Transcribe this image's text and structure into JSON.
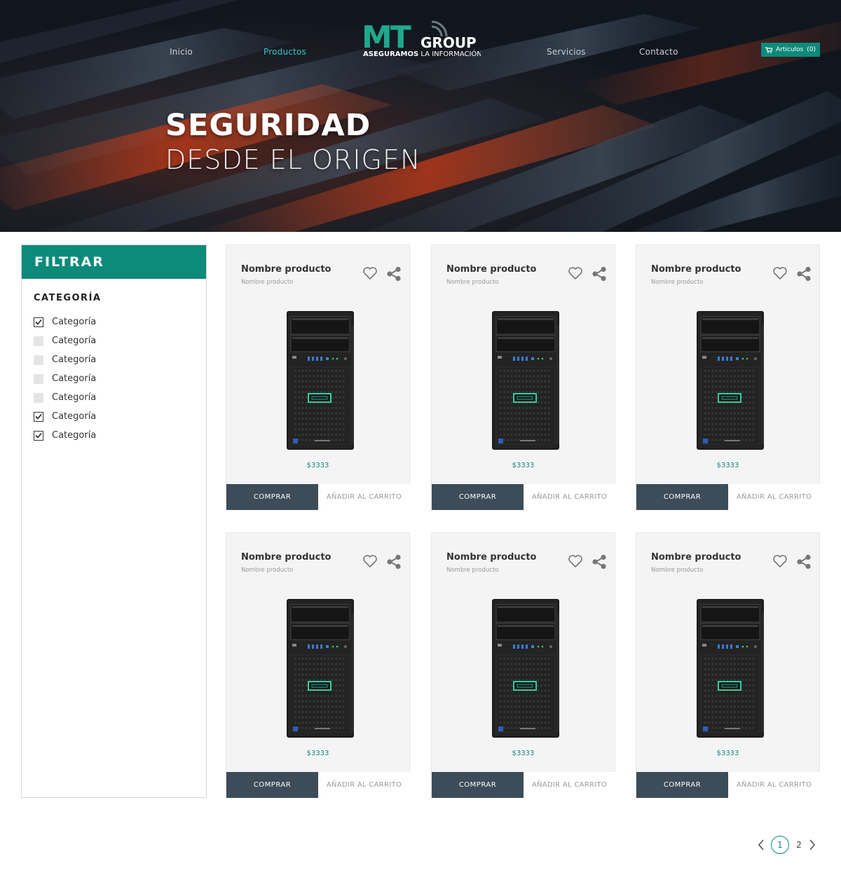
{
  "nav": {
    "items": [
      {
        "label": "Inicio",
        "active": false
      },
      {
        "label": "Productos",
        "active": true
      },
      {
        "label": "Servicios",
        "active": false
      },
      {
        "label": "Contacto",
        "active": false
      }
    ]
  },
  "logo": {
    "brand_initials": "MT",
    "brand_suffix": "GROUP",
    "tagline_bold": "ASEGURAMOS",
    "tagline_rest": " LA INFORMACIÓN"
  },
  "cart": {
    "label": "Articulos",
    "count": "(0)"
  },
  "hero": {
    "title": "SEGURIDAD",
    "subtitle": "DESDE EL ORIGEN"
  },
  "filter": {
    "title": "FILTRAR",
    "category_title": "CATEGORÍA",
    "categories": [
      {
        "label": "Categoría",
        "checked": true
      },
      {
        "label": "Categoría",
        "checked": false
      },
      {
        "label": "Categoría",
        "checked": false
      },
      {
        "label": "Categoría",
        "checked": false
      },
      {
        "label": "Categoría",
        "checked": false
      },
      {
        "label": "Categoría",
        "checked": true
      },
      {
        "label": "Categoría",
        "checked": true
      }
    ]
  },
  "products": [
    {
      "name": "Nombre producto",
      "subtitle": "Nombre producto",
      "price": "$3333",
      "buy_label": "COMPRAR",
      "cart_label": "AÑADIR AL CARRITO"
    },
    {
      "name": "Nombre producto",
      "subtitle": "Nombre producto",
      "price": "$3333",
      "buy_label": "COMPRAR",
      "cart_label": "AÑADIR AL CARRITO"
    },
    {
      "name": "Nombre producto",
      "subtitle": "Nombre producto",
      "price": "$3333",
      "buy_label": "COMPRAR",
      "cart_label": "AÑADIR AL CARRITO"
    },
    {
      "name": "Nombre producto",
      "subtitle": "Nombre producto",
      "price": "$3333",
      "buy_label": "COMPRAR",
      "cart_label": "AÑADIR AL CARRITO"
    },
    {
      "name": "Nombre producto",
      "subtitle": "Nombre producto",
      "price": "$3333",
      "buy_label": "COMPRAR",
      "cart_label": "AÑADIR AL CARRITO"
    },
    {
      "name": "Nombre producto",
      "subtitle": "Nombre producto",
      "price": "$3333",
      "buy_label": "COMPRAR",
      "cart_label": "AÑADIR AL CARRITO"
    }
  ],
  "pagination": {
    "pages": [
      "1",
      "2"
    ],
    "current": "1"
  },
  "colors": {
    "accent": "#0e8a7a",
    "nav_active": "#33c4c4",
    "button_dark": "#3c4c58"
  }
}
